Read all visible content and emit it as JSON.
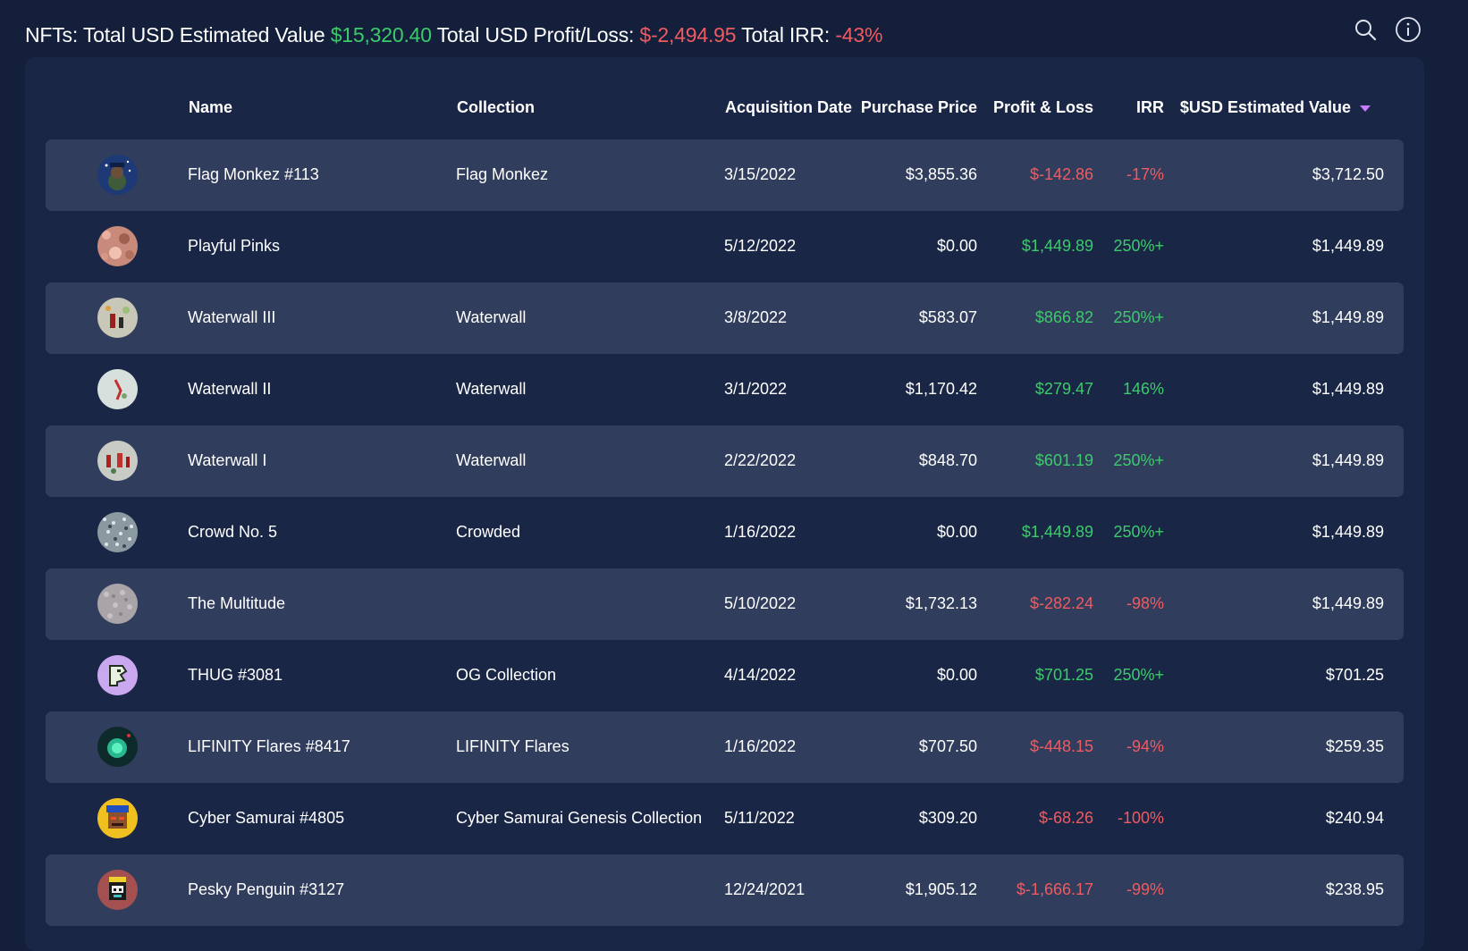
{
  "summary": {
    "label_value": "NFTs: Total USD Estimated Value",
    "total_value": "$15,320.40",
    "label_pl": "Total USD Profit/Loss:",
    "total_pl": "$-2,494.95",
    "label_irr": "Total IRR:",
    "total_irr": "-43%"
  },
  "icons": {
    "search": "search-icon",
    "info": "info-icon"
  },
  "colors": {
    "positive": "#3ccb6b",
    "negative": "#ef5b61",
    "sort": "#c77dff"
  },
  "table": {
    "headers": {
      "name": "Name",
      "collection": "Collection",
      "date": "Acquisition Date",
      "price": "Purchase Price",
      "pl": "Profit & Loss",
      "irr": "IRR",
      "value": "$USD Estimated Value"
    },
    "rows": [
      {
        "name": "Flag Monkez #113",
        "collection": "Flag Monkez",
        "date": "3/15/2022",
        "price": "$3,855.36",
        "pl": "$-142.86",
        "irr": "-17%",
        "value": "$3,712.50",
        "positive": false
      },
      {
        "name": "Playful Pinks",
        "collection": "",
        "date": "5/12/2022",
        "price": "$0.00",
        "pl": "$1,449.89",
        "irr": "250%+",
        "value": "$1,449.89",
        "positive": true
      },
      {
        "name": "Waterwall III",
        "collection": "Waterwall",
        "date": "3/8/2022",
        "price": "$583.07",
        "pl": "$866.82",
        "irr": "250%+",
        "value": "$1,449.89",
        "positive": true
      },
      {
        "name": "Waterwall II",
        "collection": "Waterwall",
        "date": "3/1/2022",
        "price": "$1,170.42",
        "pl": "$279.47",
        "irr": "146%",
        "value": "$1,449.89",
        "positive": true
      },
      {
        "name": "Waterwall I",
        "collection": "Waterwall",
        "date": "2/22/2022",
        "price": "$848.70",
        "pl": "$601.19",
        "irr": "250%+",
        "value": "$1,449.89",
        "positive": true
      },
      {
        "name": "Crowd No. 5",
        "collection": "Crowded",
        "date": "1/16/2022",
        "price": "$0.00",
        "pl": "$1,449.89",
        "irr": "250%+",
        "value": "$1,449.89",
        "positive": true
      },
      {
        "name": "The Multitude",
        "collection": "",
        "date": "5/10/2022",
        "price": "$1,732.13",
        "pl": "$-282.24",
        "irr": "-98%",
        "value": "$1,449.89",
        "positive": false
      },
      {
        "name": "THUG #3081",
        "collection": "OG Collection",
        "date": "4/14/2022",
        "price": "$0.00",
        "pl": "$701.25",
        "irr": "250%+",
        "value": "$701.25",
        "positive": true
      },
      {
        "name": "LIFINITY Flares #8417",
        "collection": "LIFINITY Flares",
        "date": "1/16/2022",
        "price": "$707.50",
        "pl": "$-448.15",
        "irr": "-94%",
        "value": "$259.35",
        "positive": false
      },
      {
        "name": "Cyber Samurai #4805",
        "collection": "Cyber Samurai Genesis Collection",
        "date": "5/11/2022",
        "price": "$309.20",
        "pl": "$-68.26",
        "irr": "-100%",
        "value": "$240.94",
        "positive": false
      },
      {
        "name": "Pesky Penguin #3127",
        "collection": "",
        "date": "12/24/2021",
        "price": "$1,905.12",
        "pl": "$-1,666.17",
        "irr": "-99%",
        "value": "$238.95",
        "positive": false
      }
    ]
  }
}
